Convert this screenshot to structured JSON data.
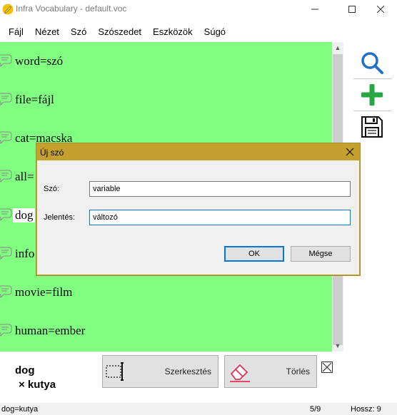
{
  "window": {
    "title": "Infra Vocabulary - default.voc",
    "icon": "pencil-circle-icon"
  },
  "menu": [
    "Fájl",
    "Nézet",
    "Szó",
    "Szószedet",
    "Eszközök",
    "Súgó"
  ],
  "list": {
    "background": "#80ff80",
    "items": [
      {
        "text": "word=szó"
      },
      {
        "text": "file=fájl"
      },
      {
        "text": "cat=macska"
      },
      {
        "text": "all="
      },
      {
        "text": "dog"
      },
      {
        "text": "info"
      },
      {
        "text": "movie=film"
      },
      {
        "text": "human=ember"
      }
    ]
  },
  "toolbar": {
    "search_icon": "magnifier-icon",
    "add_icon": "plus-icon",
    "save_icon": "floppy-icon",
    "accent_blue": "#1f6fc4",
    "accent_green": "#28a745"
  },
  "detail": {
    "word": "dog",
    "meaning": "× kutya",
    "edit_label": "Szerkesztés",
    "delete_label": "Törlés"
  },
  "status": {
    "current": "dog=kutya",
    "position": "5/9",
    "length": "Hossz: 9"
  },
  "dialog": {
    "title": "Új szó",
    "word_label": "Szó:",
    "word_value": "variable",
    "meaning_label": "Jelentés:",
    "meaning_value": "változó",
    "ok_label": "OK",
    "cancel_label": "Mégse",
    "title_color": "#c4a12f"
  }
}
